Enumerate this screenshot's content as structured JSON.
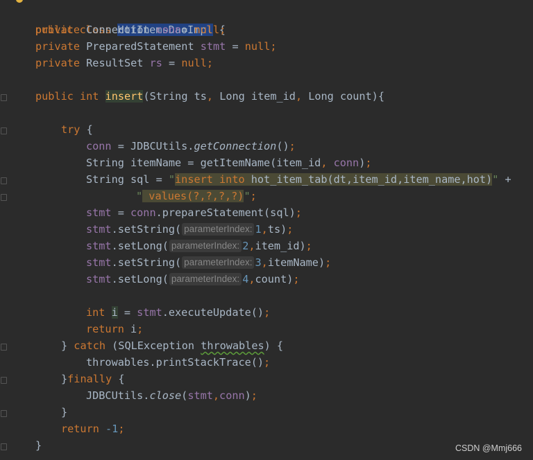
{
  "code": {
    "l1": {
      "kw": "public class ",
      "cls": "HotItemsDaoImpl",
      "brace": " {"
    },
    "l2": {
      "kw": "private ",
      "type": "Connection ",
      "fld": "conn",
      "eq": "= ",
      "val": "null",
      "semi": ";"
    },
    "l3": {
      "kw": "private ",
      "type": "PreparedStatement ",
      "fld": "stmt",
      "eq": " = ",
      "val": "null",
      "semi": ";"
    },
    "l4": {
      "kw": "private ",
      "type": "ResultSet ",
      "fld": "rs",
      "eq": " = ",
      "val": "null",
      "semi": ";"
    },
    "l6": {
      "kw": "public int ",
      "method": "insert",
      "p1": "(String ts",
      "c1": ", ",
      "p2": "Long item_id",
      "c2": ", ",
      "p3": "Long count){"
    },
    "l8": {
      "kw": "try",
      "rest": " {"
    },
    "l9": {
      "fld": "conn",
      "a": " = JDBCUtils.",
      "m": "getConnection",
      "b": "()",
      "semi": ";"
    },
    "l10": {
      "a": "String itemName = getItemName(item_id",
      "c": ", ",
      "fld": "conn",
      "b": ")",
      "semi": ";"
    },
    "l11": {
      "a": "String sql = ",
      "q": "\"",
      "sql1": "insert into ",
      "sql2": "hot_item_tab(dt,item_id,item_name,hot)",
      "q2": "\"",
      "plus": " +"
    },
    "l12": {
      "q": "\"",
      "sql": " values(?,?,?,?)",
      "q2": "\"",
      "semi": ";"
    },
    "l13": {
      "fld": "stmt",
      "a": " = ",
      "fld2": "conn",
      "b": ".prepareStatement(sql)",
      "semi": ";"
    },
    "l14": {
      "fld": "stmt",
      "a": ".setString(",
      "hint": "parameterIndex:",
      "num": "1",
      "c": ",",
      "b": "ts)",
      "semi": ";"
    },
    "l15": {
      "fld": "stmt",
      "a": ".setLong(",
      "hint": "parameterIndex:",
      "num": "2",
      "c": ",",
      "b": "item_id)",
      "semi": ";"
    },
    "l16": {
      "fld": "stmt",
      "a": ".setString(",
      "hint": "parameterIndex:",
      "num": "3",
      "c": ",",
      "b": "itemName)",
      "semi": ";"
    },
    "l17": {
      "fld": "stmt",
      "a": ".setLong(",
      "hint": "parameterIndex:",
      "num": "4",
      "c": ",",
      "b": "count)",
      "semi": ";"
    },
    "l19": {
      "kw": "int ",
      "var": "i",
      "a": " = ",
      "fld": "stmt",
      "b": ".executeUpdate()",
      "semi": ";"
    },
    "l20": {
      "kw": "return ",
      "a": "i",
      "semi": ";"
    },
    "l21": {
      "a": "} ",
      "kw": "catch",
      "b": " (SQLException ",
      "warn": "throwables",
      "c": ") {"
    },
    "l22": {
      "a": "throwables.printStackTrace()",
      "semi": ";"
    },
    "l23": {
      "a": "}",
      "kw": "finally",
      "b": " {"
    },
    "l24": {
      "a": "JDBCUtils.",
      "m": "close",
      "b": "(",
      "fld": "stmt",
      "c": ",",
      "fld2": "conn",
      "d": ")",
      "semi": ";"
    },
    "l25": {
      "a": "}"
    },
    "l26": {
      "kw": "return ",
      "num": "-1",
      "semi": ";"
    },
    "l27": {
      "a": "}"
    }
  },
  "watermark": "CSDN @Mmj666"
}
